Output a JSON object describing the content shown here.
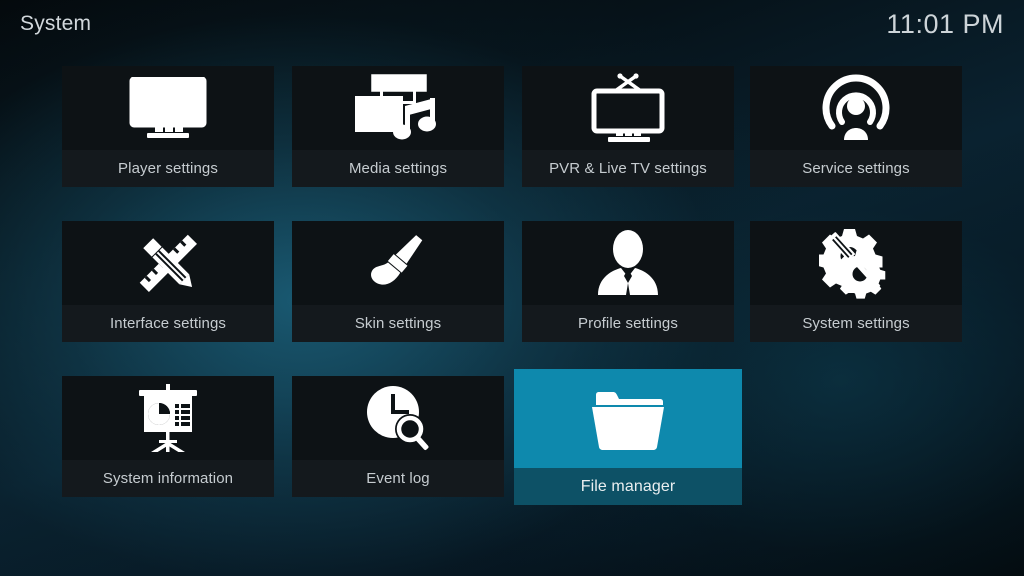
{
  "window": {
    "title": "System",
    "clock": "11:01 PM"
  },
  "theme": {
    "background_dark": "#061219",
    "background_teal": "#174a60",
    "tile_bg": "#0d1215",
    "tile_label_bg": "#14191d",
    "selected_icon_bg": "#0e89ad",
    "selected_label_bg": "#0d5166",
    "text_color": "#c6ccd0",
    "title_color": "#d2d8dc"
  },
  "grid": {
    "rows": [
      [
        {
          "label": "Player settings",
          "icon": "monitor-play-icon",
          "selected": false
        },
        {
          "label": "Media settings",
          "icon": "filmstrip-photo-music-icon",
          "selected": false
        },
        {
          "label": "PVR & Live TV settings",
          "icon": "tv-antenna-icon",
          "selected": false
        },
        {
          "label": "Service settings",
          "icon": "broadcast-person-icon",
          "selected": false
        }
      ],
      [
        {
          "label": "Interface settings",
          "icon": "pencil-ruler-icon",
          "selected": false
        },
        {
          "label": "Skin settings",
          "icon": "paintbrush-icon",
          "selected": false
        },
        {
          "label": "Profile settings",
          "icon": "person-bust-icon",
          "selected": false
        },
        {
          "label": "System settings",
          "icon": "gears-screwdriver-icon",
          "selected": false
        }
      ],
      [
        {
          "label": "System information",
          "icon": "presentation-chart-icon",
          "selected": false
        },
        {
          "label": "Event log",
          "icon": "clock-magnifier-icon",
          "selected": false
        },
        {
          "label": "File manager",
          "icon": "folder-icon",
          "selected": true
        }
      ]
    ]
  }
}
